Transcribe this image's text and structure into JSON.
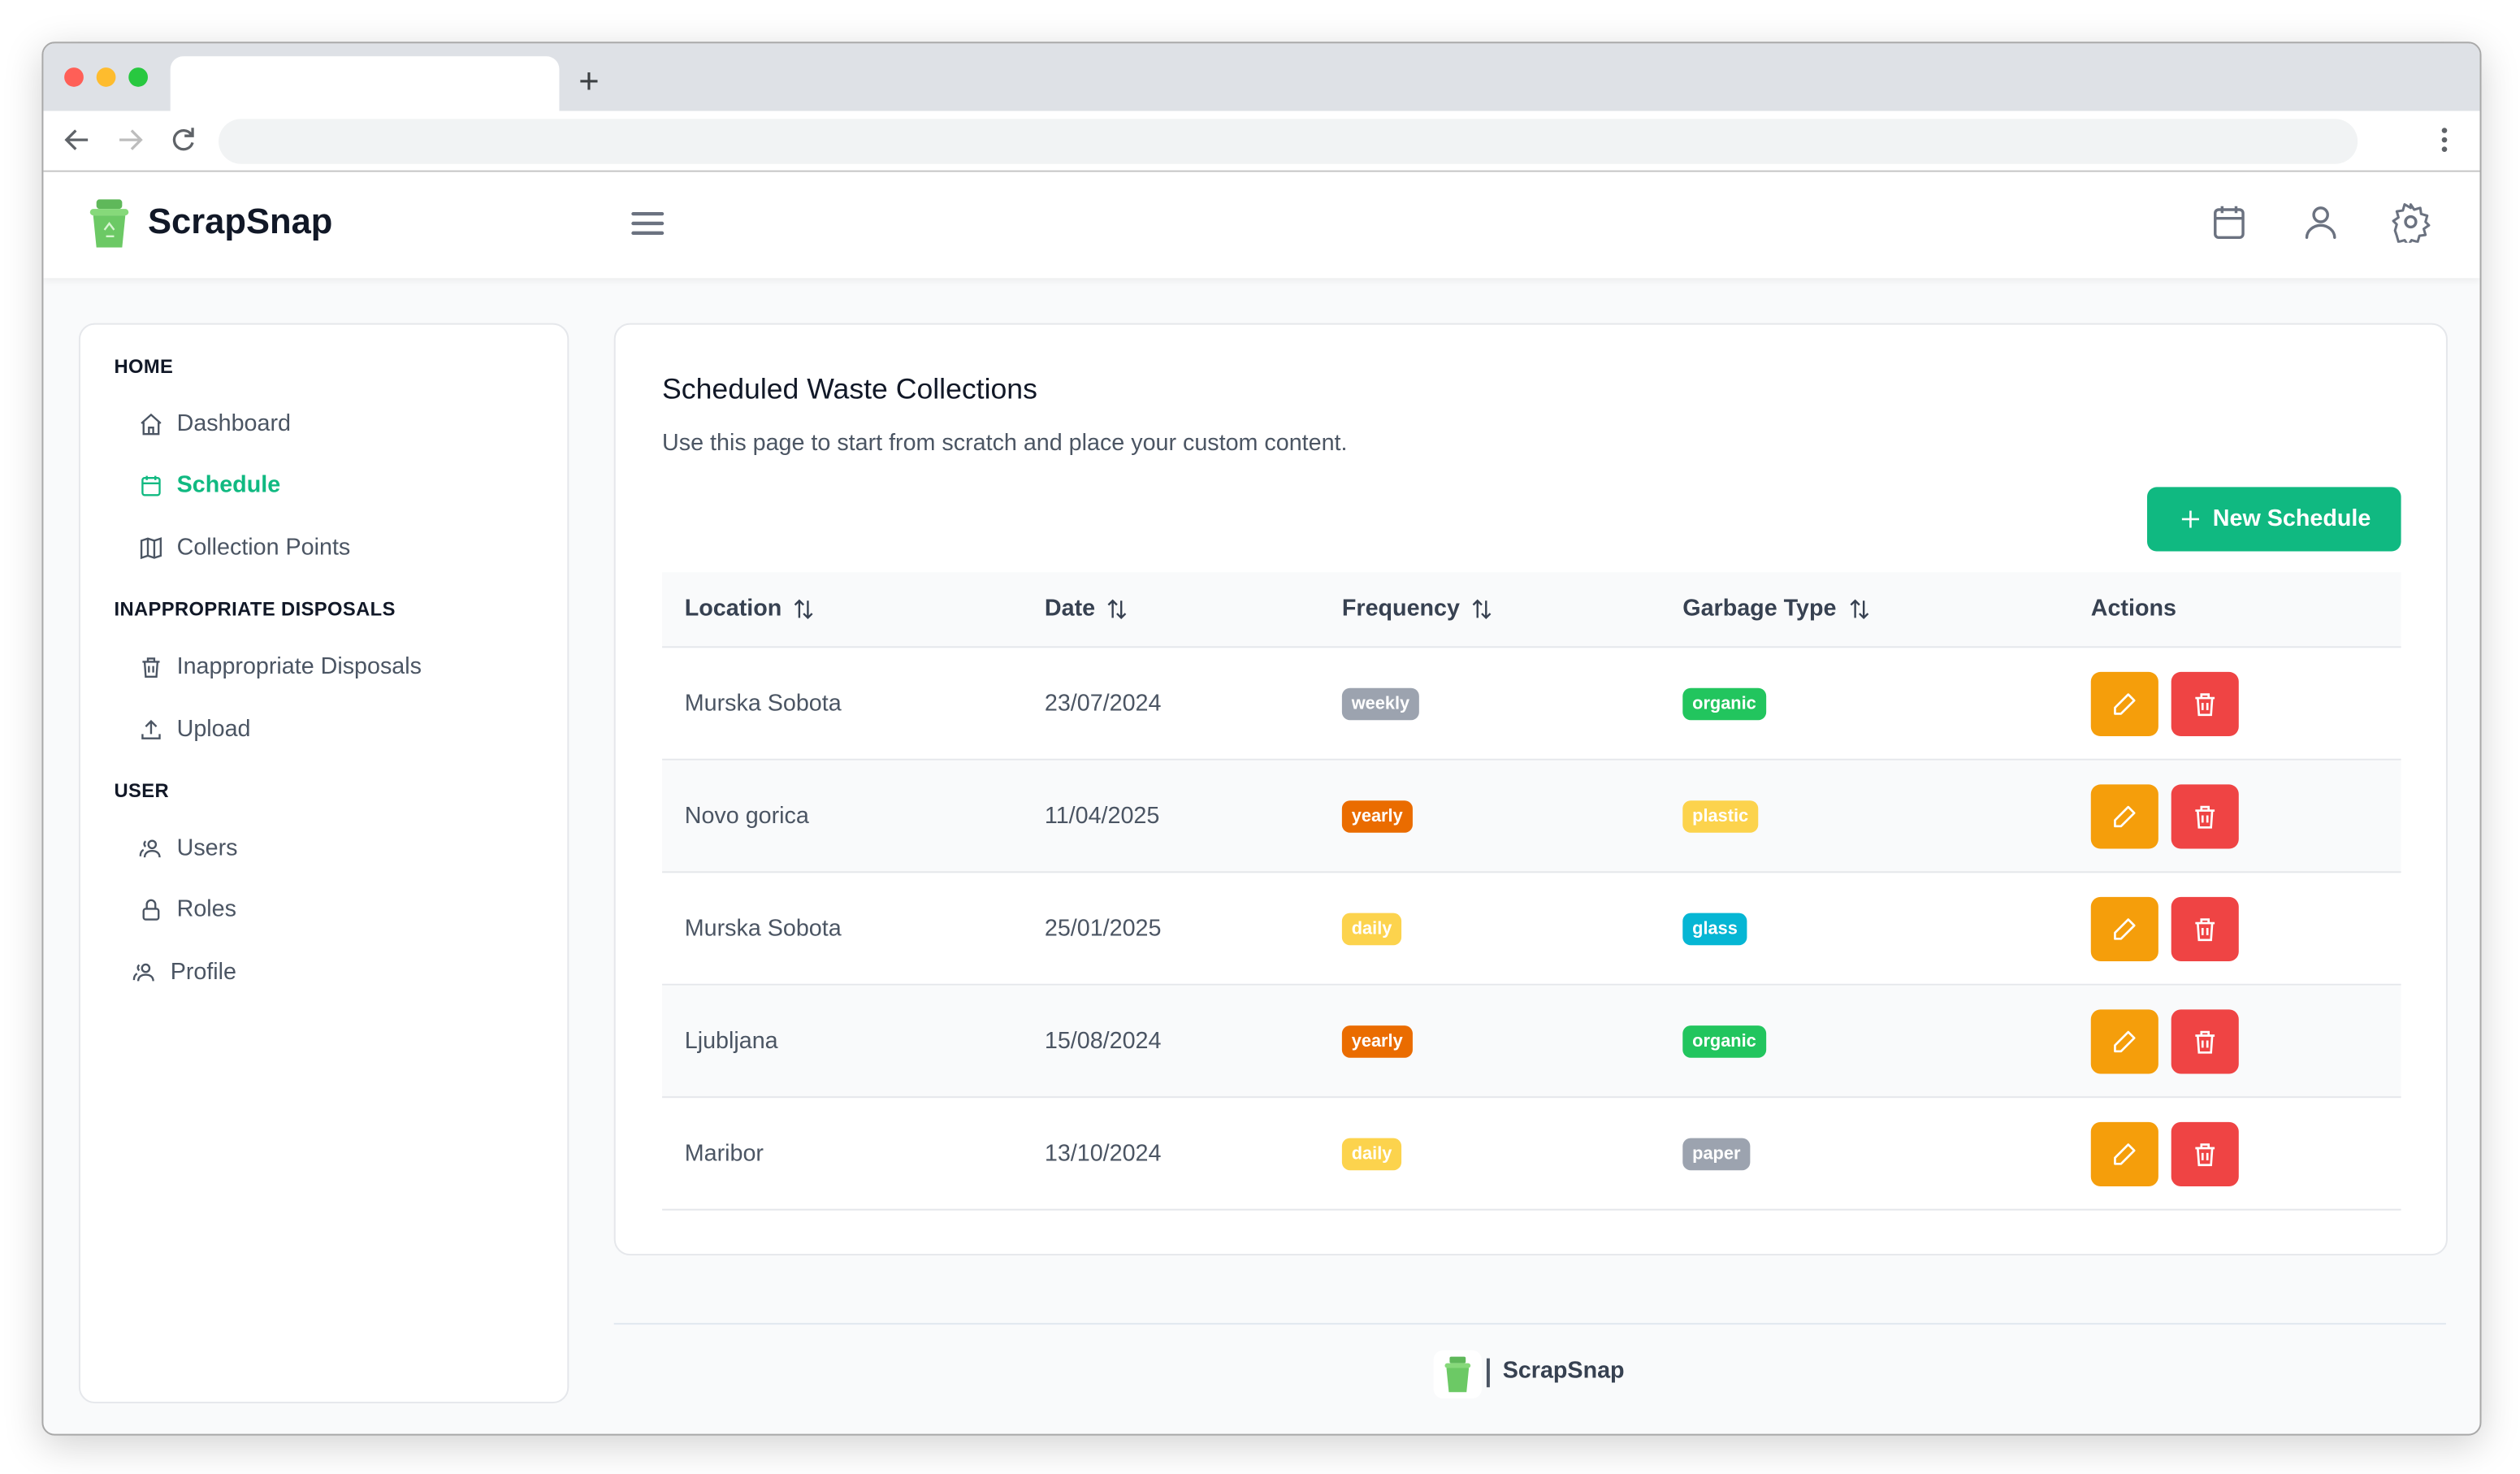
{
  "browser": {
    "new_tab_label": "+",
    "traffic_colors": [
      "#ff5f57",
      "#febc2e",
      "#28c840"
    ]
  },
  "app": {
    "brand": "ScrapSnap",
    "accent": "#10b981"
  },
  "topbar_icons": [
    "calendar-icon",
    "user-icon",
    "gear-icon"
  ],
  "sidebar": {
    "sections": [
      {
        "title": "HOME",
        "items": [
          {
            "label": "Dashboard",
            "icon": "home-icon",
            "active": false
          },
          {
            "label": "Schedule",
            "icon": "calendar-icon",
            "active": true
          },
          {
            "label": "Collection Points",
            "icon": "map-icon",
            "active": false
          }
        ]
      },
      {
        "title": "INAPPROPRIATE DISPOSALS",
        "items": [
          {
            "label": "Inappropriate Disposals",
            "icon": "trash-icon",
            "active": false
          },
          {
            "label": "Upload",
            "icon": "upload-icon",
            "active": false
          }
        ]
      },
      {
        "title": "USER",
        "items": [
          {
            "label": "Users",
            "icon": "users-icon",
            "active": false
          },
          {
            "label": "Roles",
            "icon": "lock-icon",
            "active": false
          },
          {
            "label": "Profile",
            "icon": "users-icon",
            "active": false
          }
        ]
      }
    ]
  },
  "main": {
    "title": "Scheduled Waste Collections",
    "subtitle": "Use this page to start from scratch and place your custom content.",
    "new_button": "New Schedule",
    "columns": [
      "Location",
      "Date",
      "Frequency",
      "Garbage Type",
      "Actions"
    ],
    "rows": [
      {
        "location": "Murska Sobota",
        "date": "23/07/2024",
        "frequency": "weekly",
        "frequency_color": "#9ca3af",
        "garbage": "organic",
        "garbage_color": "#22c55e"
      },
      {
        "location": "Novo gorica",
        "date": "11/04/2025",
        "frequency": "yearly",
        "frequency_color": "#ea6c00",
        "garbage": "plastic",
        "garbage_color": "#fcd34d"
      },
      {
        "location": "Murska Sobota",
        "date": "25/01/2025",
        "frequency": "daily",
        "frequency_color": "#fcd34d",
        "garbage": "glass",
        "garbage_color": "#06b6d4"
      },
      {
        "location": "Ljubljana",
        "date": "15/08/2024",
        "frequency": "yearly",
        "frequency_color": "#ea6c00",
        "garbage": "organic",
        "garbage_color": "#22c55e"
      },
      {
        "location": "Maribor",
        "date": "13/10/2024",
        "frequency": "daily",
        "frequency_color": "#fcd34d",
        "garbage": "paper",
        "garbage_color": "#9ca3af"
      }
    ],
    "edit_color": "#f59e0b",
    "delete_color": "#ef4444"
  },
  "footer": {
    "brand": "ScrapSnap"
  }
}
